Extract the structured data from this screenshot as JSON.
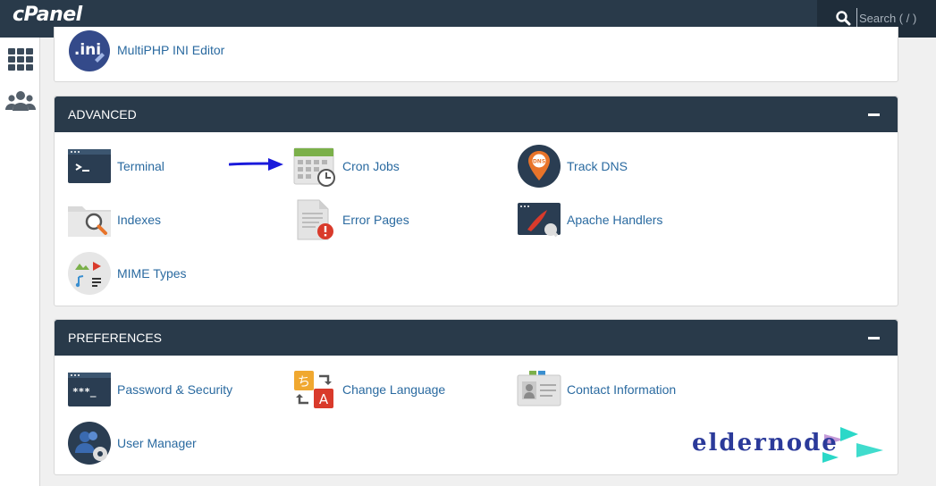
{
  "app": {
    "logo": "cPanel"
  },
  "search": {
    "placeholder": "Search ( / )"
  },
  "sidebar": {
    "items": [
      {
        "icon": "grid-icon"
      },
      {
        "icon": "users-icon"
      }
    ]
  },
  "top_item": {
    "label": "MultiPHP INI Editor",
    "icon": "ini-file-icon"
  },
  "advanced": {
    "title": "ADVANCED",
    "items": [
      {
        "label": "Terminal",
        "icon": "terminal-icon"
      },
      {
        "label": "Cron Jobs",
        "icon": "calendar-clock-icon"
      },
      {
        "label": "Track DNS",
        "icon": "dns-pin-icon"
      },
      {
        "label": "Indexes",
        "icon": "folder-search-icon"
      },
      {
        "label": "Error Pages",
        "icon": "error-page-icon"
      },
      {
        "label": "Apache Handlers",
        "icon": "apache-handler-icon"
      },
      {
        "label": "MIME Types",
        "icon": "media-types-icon"
      }
    ]
  },
  "preferences": {
    "title": "PREFERENCES",
    "items": [
      {
        "label": "Password & Security",
        "icon": "password-terminal-icon"
      },
      {
        "label": "Change Language",
        "icon": "language-icon"
      },
      {
        "label": "Contact Information",
        "icon": "contact-card-icon"
      },
      {
        "label": "User Manager",
        "icon": "user-manager-icon"
      }
    ]
  },
  "watermark": {
    "text": "eldernode"
  },
  "colors": {
    "topbar": "#293a4a",
    "link": "#2a6aa0",
    "accent_orange": "#e8742a",
    "annotation_arrow": "#1a1adb"
  }
}
